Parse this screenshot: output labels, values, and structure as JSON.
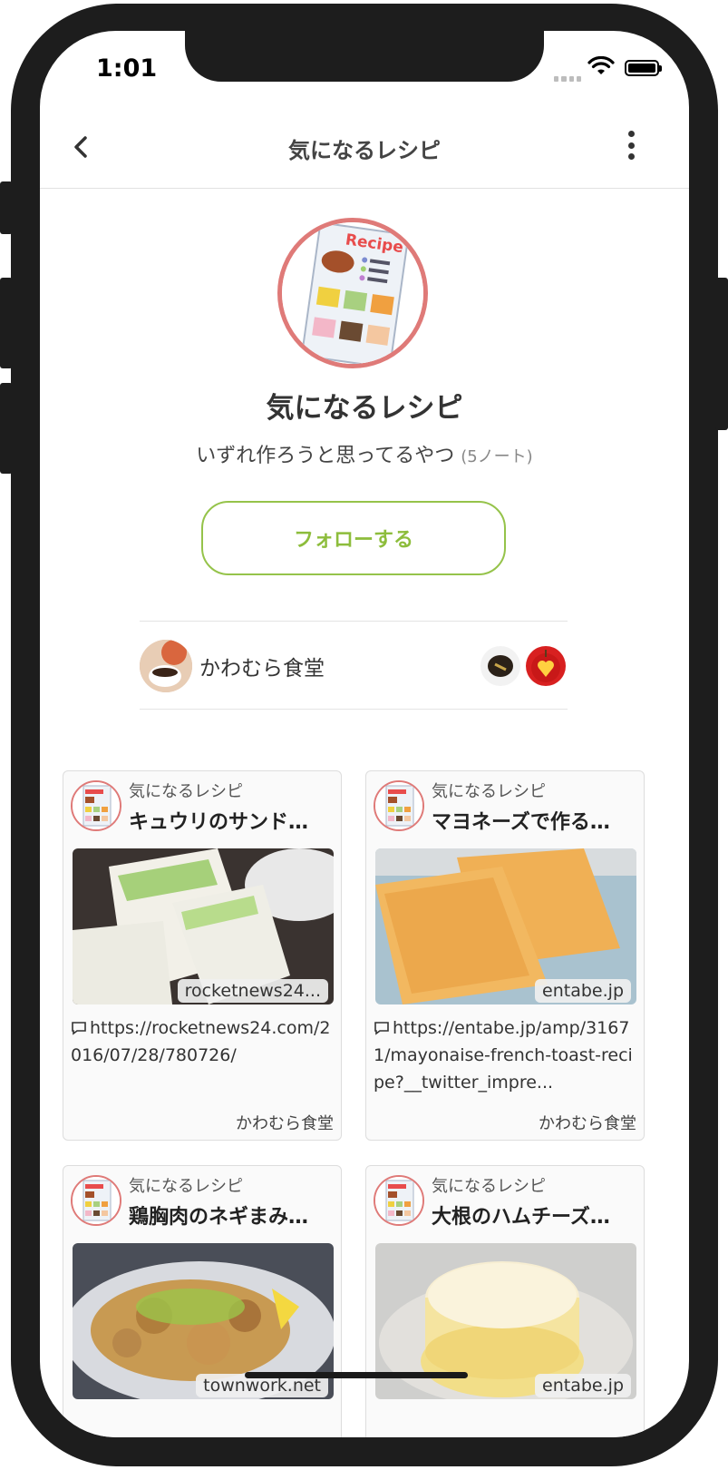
{
  "status_bar": {
    "time": "1:01"
  },
  "nav": {
    "title": "気になるレシピ"
  },
  "collection": {
    "image_label": "Recipe",
    "title": "気になるレシピ",
    "description": "いずれ作ろうと思ってるやつ",
    "note_count": "(5ノート)",
    "follow_label": "フォローする",
    "owner_name": "かわむら食堂"
  },
  "cards": [
    {
      "collection": "気になるレシピ",
      "title": "キュウリのサンド…",
      "domain": "rocketnews24...",
      "url": "https://rocketnews24.com/2016/07/28/780726/",
      "owner": "かわむら食堂"
    },
    {
      "collection": "気になるレシピ",
      "title": "マヨネーズで作る…",
      "domain": "entabe.jp",
      "url": "https://entabe.jp/amp/31671/mayonaise-french-toast-recipe?__twitter_impre...",
      "owner": "かわむら食堂"
    },
    {
      "collection": "気になるレシピ",
      "title": "鶏胸肉のネギまみ…",
      "domain": "townwork.net",
      "url": "",
      "owner": ""
    },
    {
      "collection": "気になるレシピ",
      "title": "大根のハムチーズ…",
      "domain": "entabe.jp",
      "url": "",
      "owner": ""
    }
  ],
  "colors": {
    "accent": "#8dbd3c",
    "avatar_ring": "#df7a78"
  }
}
